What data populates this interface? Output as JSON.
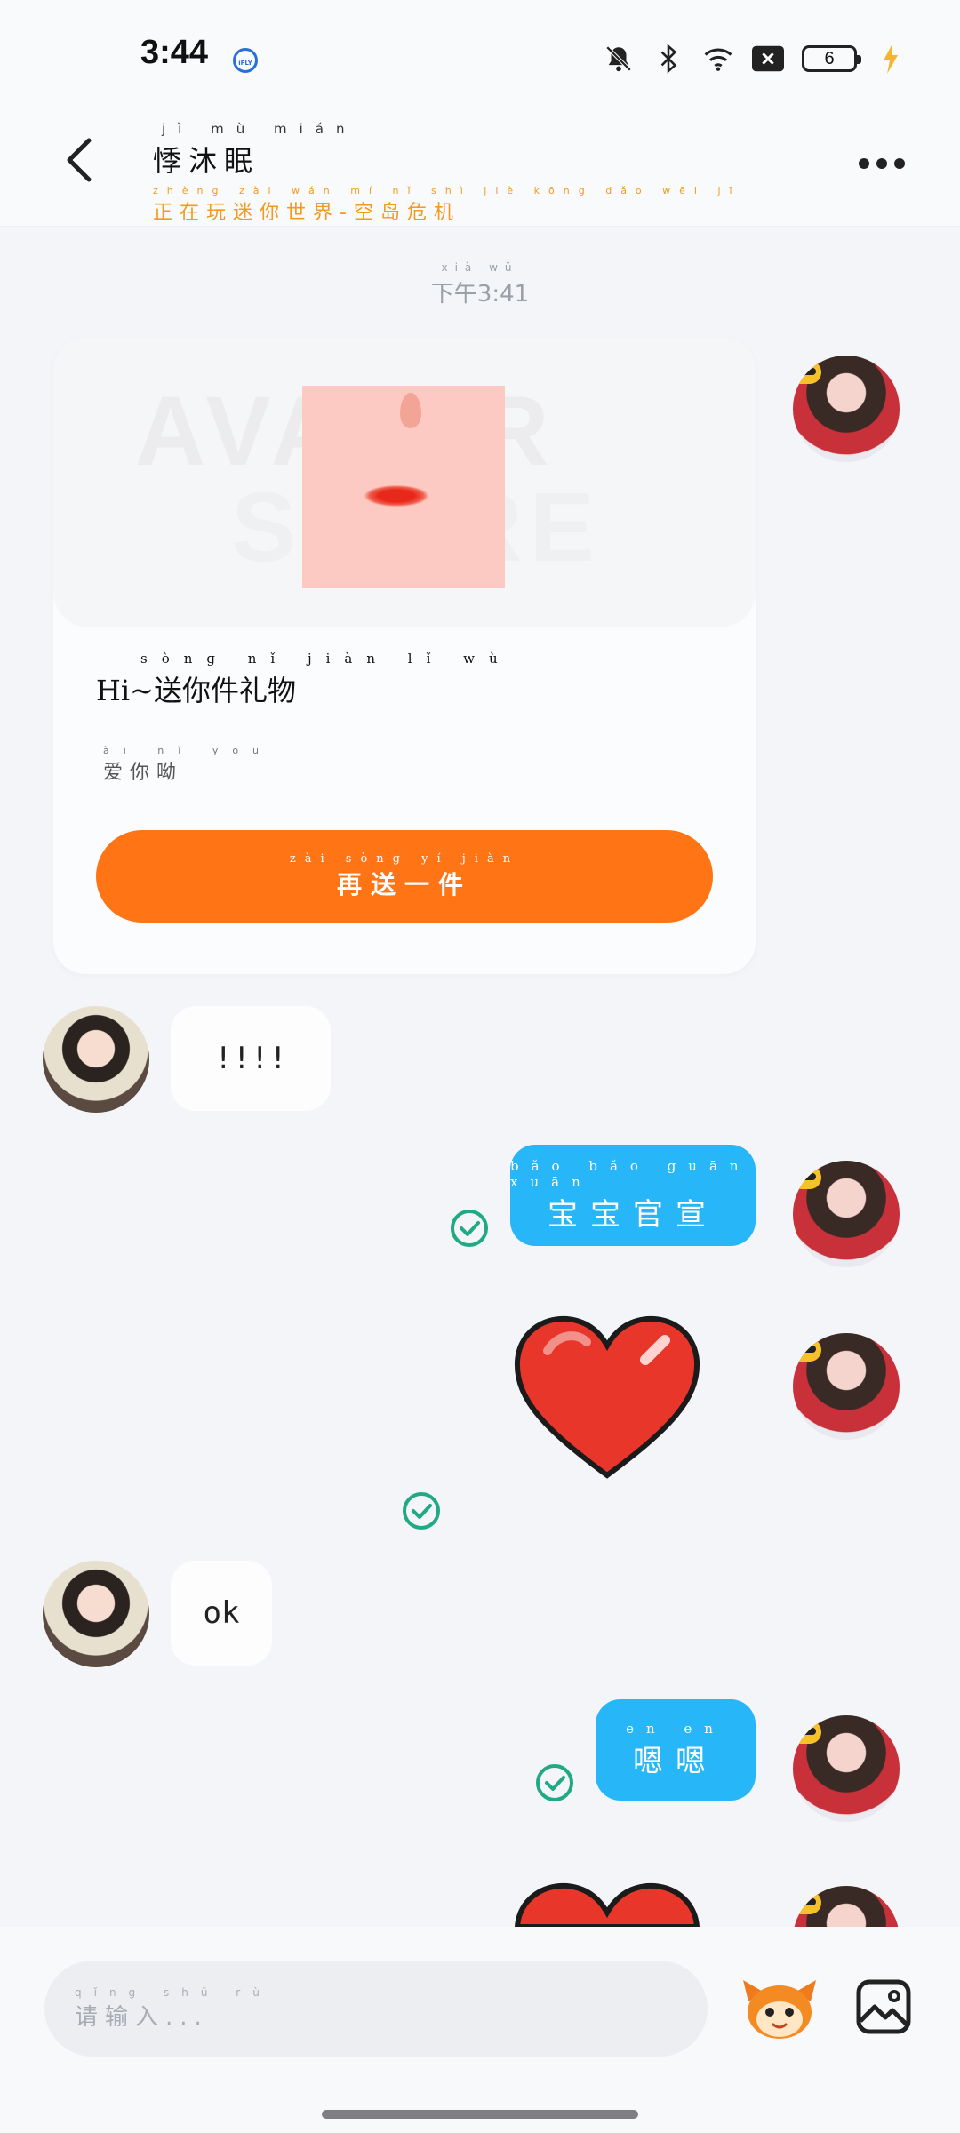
{
  "status_bar": {
    "time": "3:44",
    "ifly_badge": "iFLY",
    "battery_level": "6",
    "icons": [
      "bell-off-icon",
      "bluetooth-icon",
      "wifi-icon",
      "close-box-icon",
      "battery-icon",
      "charging-icon"
    ]
  },
  "header": {
    "title_pinyin": "jì mù mián",
    "title": "悸沐眠",
    "subtitle_pinyin": "zhèng zài wán mí nǐ shì jiè kōng dǎo wēi jī",
    "subtitle": "正在玩迷你世界-空岛危机"
  },
  "chat": {
    "timestamp_pinyin": "xià wǔ",
    "timestamp": "下午3:41",
    "gift_card": {
      "watermark_line1": "AVATAR",
      "watermark_line2": "STORE",
      "title_pinyin": "sòng nǐ jiàn lǐ wù",
      "title": "Hi~送你件礼物",
      "subtitle_pinyin": "ài nǐ yōu",
      "subtitle": "爱你呦",
      "button_pinyin": "zài sòng yí jiàn",
      "button_label": "再送一件"
    },
    "messages": [
      {
        "side": "left",
        "text": "!!!!"
      },
      {
        "side": "right",
        "pinyin": "bǎo bǎo guān xuān",
        "text": "宝宝官宣",
        "status": "read"
      },
      {
        "side": "right",
        "type": "sticker",
        "sticker": "heart",
        "status": "read"
      },
      {
        "side": "left",
        "text": "ok"
      },
      {
        "side": "right",
        "pinyin": "en en",
        "text": "嗯嗯",
        "status": "read"
      },
      {
        "side": "right",
        "type": "sticker",
        "sticker": "heart"
      }
    ]
  },
  "input_bar": {
    "placeholder_pinyin": "qǐng shū rù",
    "placeholder": "请输入..."
  },
  "colors": {
    "accent_orange": "#ff7414",
    "bubble_blue": "#27b6f7",
    "check_green": "#21a985",
    "subtitle_orange": "#f39a1e"
  }
}
